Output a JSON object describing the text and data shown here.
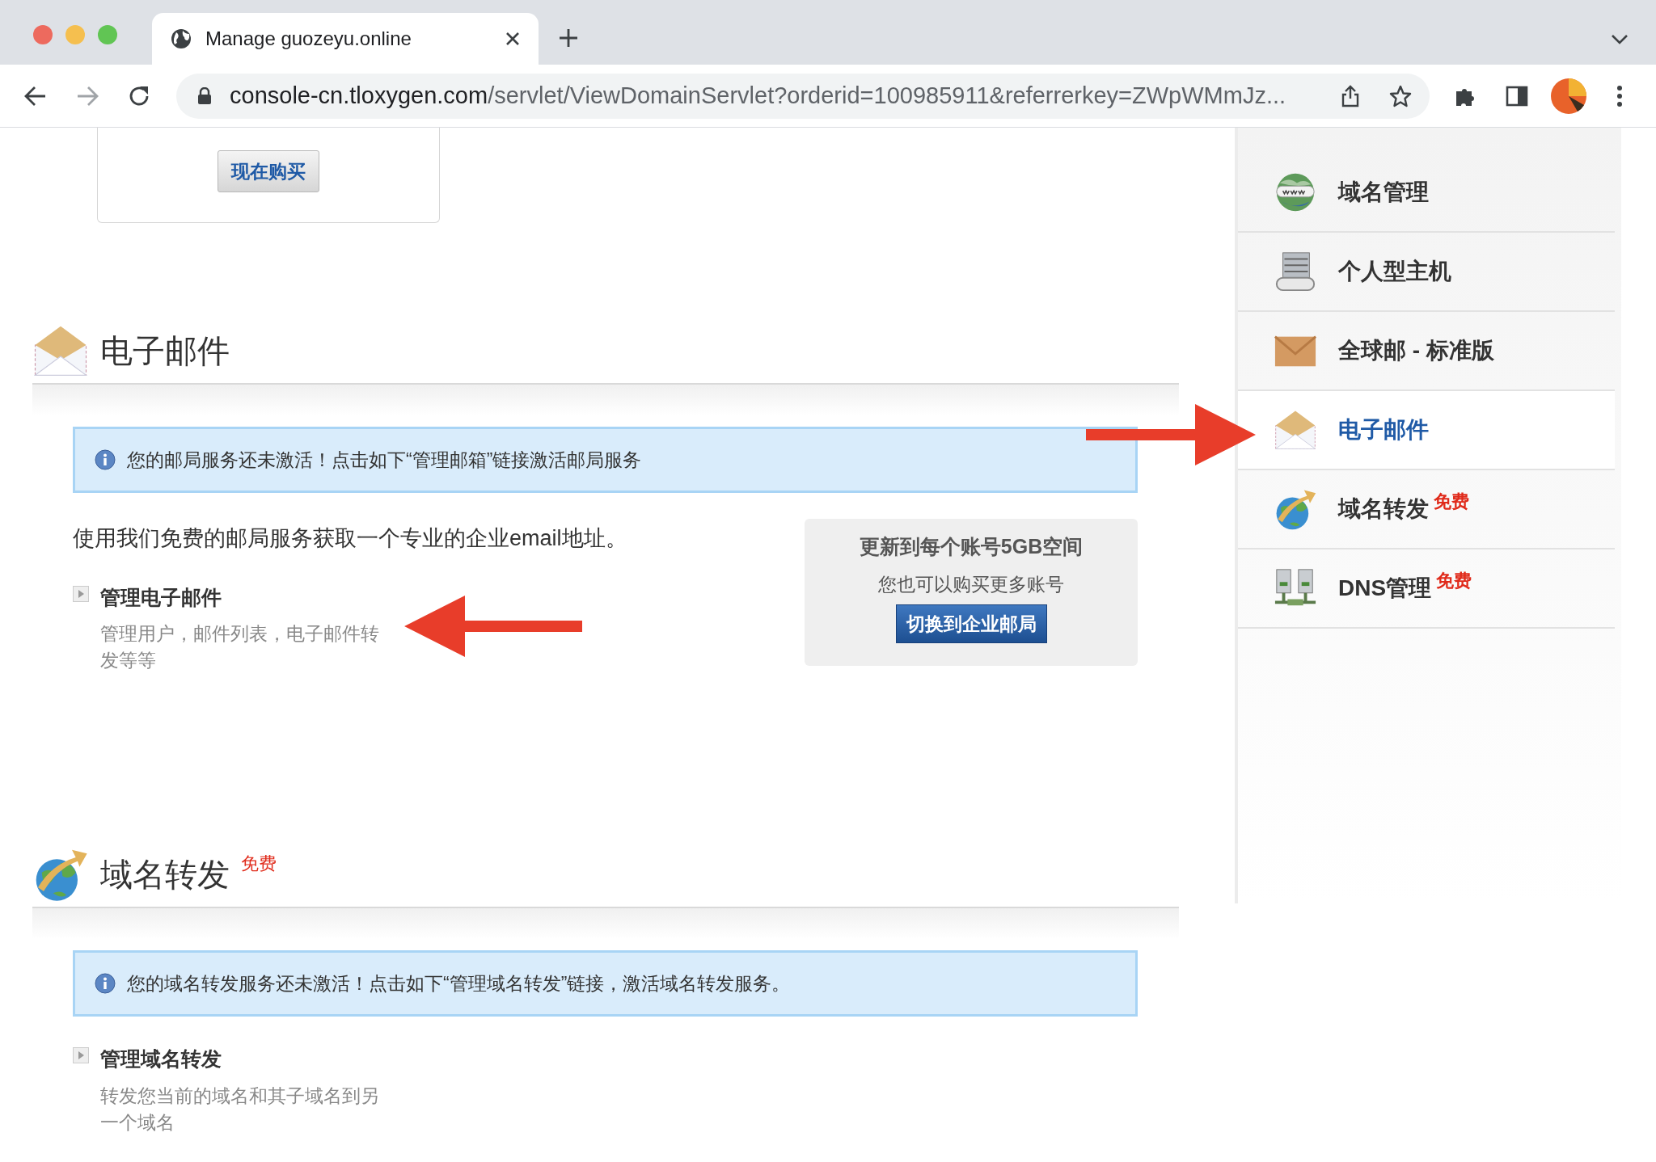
{
  "browser": {
    "tab_title": "Manage guozeyu.online",
    "url_host": "console-cn.tloxygen.com",
    "url_path": "/servlet/ViewDomainServlet?orderid=100985911&referrerkey=ZWpWMmJz..."
  },
  "buy_button": "现在购买",
  "sections": [
    {
      "kind": "email",
      "title": "电子邮件",
      "notice": "您的邮局服务还未激活！点击如下“管理邮箱”链接激活邮局服务",
      "intro": "使用我们免费的邮局服务获取一个专业的企业email地址。",
      "links": [
        {
          "title": "管理电子邮件",
          "description": "管理用户，邮件列表，电子邮件转发等等"
        }
      ],
      "upgrade": {
        "title": "更新到每个账号5GB空间",
        "text": "您也可以购买更多账号",
        "button": "切换到企业邮局"
      }
    },
    {
      "kind": "forwarding",
      "title": "域名转发",
      "badge": "免费",
      "notice": "您的域名转发服务还未激活！点击如下“管理域名转发”链接，激活域名转发服务。",
      "links": [
        {
          "title": "管理域名转发",
          "description": "转发您当前的域名和其子域名到另一个域名"
        }
      ]
    }
  ],
  "sidebar": {
    "items": [
      {
        "kind": "domains",
        "label": "域名管理",
        "selected": false
      },
      {
        "kind": "hosting",
        "label": "个人型主机",
        "selected": false
      },
      {
        "kind": "mail-global",
        "label": "全球邮 - 标准版",
        "selected": false
      },
      {
        "kind": "email",
        "label": "电子邮件",
        "selected": true
      },
      {
        "kind": "forwarding",
        "label": "域名转发",
        "badge": "免费",
        "selected": false
      },
      {
        "kind": "dns",
        "label": "DNS管理",
        "badge": "免费",
        "selected": false
      }
    ]
  }
}
